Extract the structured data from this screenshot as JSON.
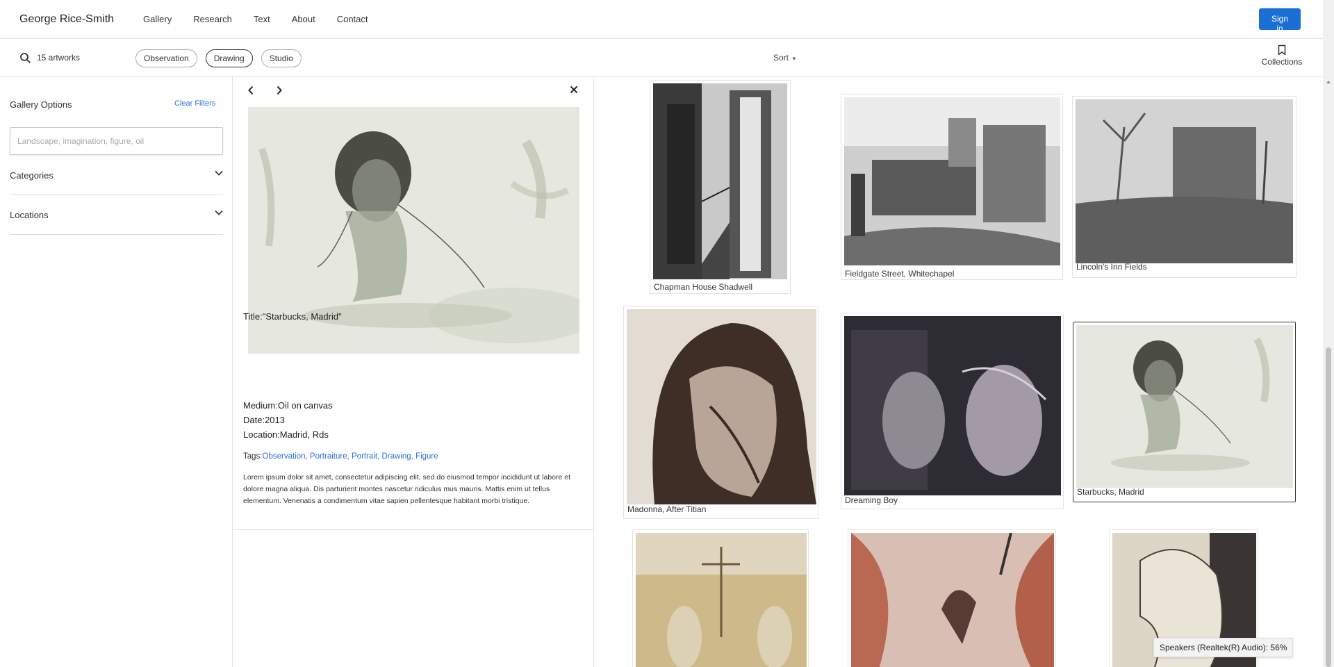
{
  "header": {
    "brand": "George Rice-Smith",
    "nav": [
      "Gallery",
      "Research",
      "Text",
      "About",
      "Contact"
    ],
    "signin_label": "Sign in"
  },
  "filterbar": {
    "count": "15 artworks",
    "chips": [
      {
        "label": "Observation",
        "active": false
      },
      {
        "label": "Drawing",
        "active": true
      },
      {
        "label": "Studio",
        "active": false
      }
    ],
    "sort_label": "Sort",
    "collections_label": "Collections",
    "icons": {
      "search": "search-icon",
      "collections": "bookmark-icon"
    }
  },
  "sidebar": {
    "title": "Gallery Options",
    "clear_label": "Clear Filters",
    "search_placeholder": "Landscape, imagination, figure, oil",
    "sections": [
      "Categories",
      "Locations"
    ]
  },
  "detail": {
    "title_label": "Title:",
    "title_value": "\"Starbucks, Madrid\"",
    "medium_label": "Medium:",
    "medium_value": "Oil on canvas",
    "date_label": "Date:",
    "date_value": "2013",
    "location_label": "Location:",
    "location_value": "Madrid, Rds",
    "tags_label": "Tags:",
    "tags": [
      "Observation,",
      "Portraiture,",
      "Portrait,",
      "Drawing,",
      "Figure"
    ],
    "description": "Lorem ipsum dolor sit amet, consectetur adipiscing elit, sed do eiusmod tempor incididunt ut labore et dolore magna aliqua. Dis parturient montes nascetur ridiculus mus mauris. Mattis enim ut tellus elementum. Venenatis a condimentum vitae sapien pellentesque habitant morbi tristique."
  },
  "gallery": {
    "items": [
      {
        "caption": "Chapman House Shadwell",
        "selected": false
      },
      {
        "caption": "Fieldgate Street, Whitechapel",
        "selected": false
      },
      {
        "caption": "Lincoln's Inn Fields",
        "selected": false
      },
      {
        "caption": "Madonna, After Titian",
        "selected": false
      },
      {
        "caption": "Dreaming Boy",
        "selected": false
      },
      {
        "caption": "Starbucks, Madrid",
        "selected": true
      },
      {
        "caption": "",
        "selected": false
      },
      {
        "caption": "",
        "selected": false
      },
      {
        "caption": "",
        "selected": false
      }
    ]
  },
  "toast": "Speakers (Realtek(R) Audio): 56%",
  "colors": {
    "accent": "#1a6fd6",
    "link": "#2a6fd6"
  }
}
